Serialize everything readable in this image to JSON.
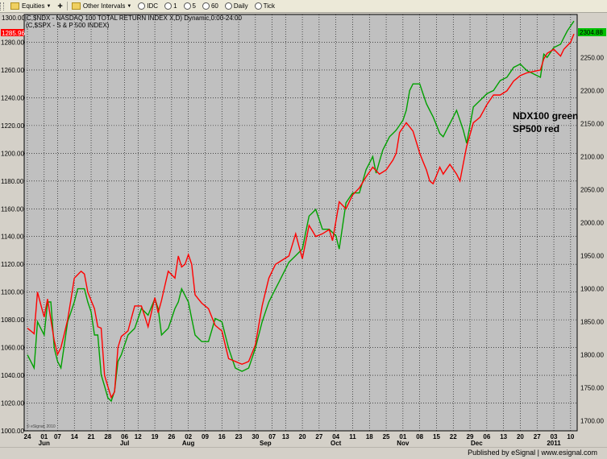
{
  "toolbar": {
    "symbols_label": "Equities",
    "intervals_label": "Other Intervals",
    "idc_label": "IDC",
    "i1_label": "1",
    "i5_label": "5",
    "i60_label": "60",
    "daily_label": "Daily",
    "tick_label": "Tick"
  },
  "chart_header": {
    "line1": "1300.00|C,$NDX - NASDAQ 100 TOTAL RETURN INDEX X,D) Dynamic,0:00-24:00",
    "line2": "(C,$SPX - S & P 500 INDEX)"
  },
  "footer": {
    "text": "Published by eSignal | www.esignal.com"
  },
  "chart_data": {
    "type": "line",
    "colors": {
      "ndx": "#00a000",
      "spx": "#ff0000",
      "background": "#c0c0c0",
      "ndx_badge": "#00c000",
      "spx_badge": "#ff0000"
    },
    "annotation_lines": [
      "NDX100 green",
      "SP500 red"
    ],
    "watermark": "© eSignal, 2010",
    "left_axis": {
      "min": 1000,
      "max": 1300,
      "ticks": [
        "1000.00",
        "1020.00",
        "1040.00",
        "1060.00",
        "1080.00",
        "1100.00",
        "1120.00",
        "1140.00",
        "1160.00",
        "1180.00",
        "1200.00",
        "1220.00",
        "1240.00",
        "1260.00",
        "1280.00"
      ]
    },
    "right_axis": {
      "min": 1685,
      "max": 2315,
      "ticks": [
        "1700.00",
        "1750.00",
        "1800.00",
        "1850.00",
        "1900.00",
        "1950.00",
        "2000.00",
        "2050.00",
        "2100.00",
        "2150.00",
        "2200.00",
        "2250.00"
      ]
    },
    "last_values": {
      "spx": "1285.96",
      "ndx": "2304.88"
    },
    "x_day_ticks": [
      "24",
      "01",
      "07",
      "14",
      "21",
      "28",
      "06",
      "12",
      "19",
      "26",
      "02",
      "09",
      "16",
      "23",
      "30",
      "07",
      "13",
      "20",
      "27",
      "04",
      "11",
      "18",
      "25",
      "01",
      "08",
      "15",
      "22",
      "29",
      "06",
      "13",
      "20",
      "27",
      "03",
      "10"
    ],
    "x_tick_index": [
      0,
      5,
      9,
      14,
      19,
      24,
      29,
      33,
      38,
      43,
      48,
      53,
      58,
      63,
      68,
      73,
      77,
      82,
      87,
      92,
      97,
      102,
      107,
      112,
      117,
      122,
      127,
      132,
      137,
      142,
      147,
      152,
      157,
      162
    ],
    "month_labels": [
      {
        "label": "Jun",
        "index": 5
      },
      {
        "label": "Jul",
        "index": 29
      },
      {
        "label": "Aug",
        "index": 48
      },
      {
        "label": "Sep",
        "index": 71
      },
      {
        "label": "Oct",
        "index": 92
      },
      {
        "label": "Nov",
        "index": 112
      },
      {
        "label": "Dec",
        "index": 134
      },
      {
        "label": "2011",
        "index": 157
      }
    ],
    "num_points": 164,
    "series": [
      {
        "name": "$NDX - NASDAQ 100 TOTAL RETURN INDEX",
        "axis": "right",
        "color": "#00a000",
        "keypoints": [
          [
            0,
            1800
          ],
          [
            2,
            1780
          ],
          [
            3,
            1850
          ],
          [
            5,
            1830
          ],
          [
            6,
            1880
          ],
          [
            7,
            1880
          ],
          [
            8,
            1810
          ],
          [
            9,
            1790
          ],
          [
            10,
            1780
          ],
          [
            12,
            1850
          ],
          [
            14,
            1880
          ],
          [
            15,
            1900
          ],
          [
            17,
            1900
          ],
          [
            18,
            1880
          ],
          [
            19,
            1865
          ],
          [
            20,
            1830
          ],
          [
            21,
            1830
          ],
          [
            22,
            1770
          ],
          [
            24,
            1735
          ],
          [
            25,
            1730
          ],
          [
            26,
            1745
          ],
          [
            27,
            1790
          ],
          [
            28,
            1800
          ],
          [
            30,
            1830
          ],
          [
            32,
            1840
          ],
          [
            34,
            1870
          ],
          [
            36,
            1860
          ],
          [
            38,
            1885
          ],
          [
            39,
            1870
          ],
          [
            40,
            1830
          ],
          [
            42,
            1840
          ],
          [
            44,
            1870
          ],
          [
            45,
            1880
          ],
          [
            46,
            1900
          ],
          [
            48,
            1880
          ],
          [
            50,
            1830
          ],
          [
            52,
            1820
          ],
          [
            54,
            1820
          ],
          [
            56,
            1855
          ],
          [
            58,
            1850
          ],
          [
            60,
            1810
          ],
          [
            62,
            1780
          ],
          [
            64,
            1775
          ],
          [
            66,
            1780
          ],
          [
            68,
            1810
          ],
          [
            70,
            1850
          ],
          [
            72,
            1880
          ],
          [
            74,
            1900
          ],
          [
            76,
            1920
          ],
          [
            78,
            1940
          ],
          [
            80,
            1950
          ],
          [
            82,
            1960
          ],
          [
            84,
            2010
          ],
          [
            86,
            2020
          ],
          [
            88,
            1990
          ],
          [
            90,
            1990
          ],
          [
            92,
            1980
          ],
          [
            93,
            1960
          ],
          [
            95,
            2030
          ],
          [
            97,
            2045
          ],
          [
            99,
            2045
          ],
          [
            101,
            2080
          ],
          [
            103,
            2100
          ],
          [
            104,
            2075
          ],
          [
            106,
            2110
          ],
          [
            108,
            2130
          ],
          [
            110,
            2140
          ],
          [
            112,
            2155
          ],
          [
            113,
            2170
          ],
          [
            114,
            2200
          ],
          [
            115,
            2210
          ],
          [
            117,
            2210
          ],
          [
            119,
            2180
          ],
          [
            121,
            2160
          ],
          [
            123,
            2135
          ],
          [
            124,
            2130
          ],
          [
            126,
            2150
          ],
          [
            128,
            2170
          ],
          [
            130,
            2140
          ],
          [
            131,
            2120
          ],
          [
            133,
            2175
          ],
          [
            135,
            2185
          ],
          [
            137,
            2195
          ],
          [
            139,
            2200
          ],
          [
            141,
            2215
          ],
          [
            143,
            2220
          ],
          [
            145,
            2235
          ],
          [
            147,
            2240
          ],
          [
            149,
            2230
          ],
          [
            151,
            2225
          ],
          [
            153,
            2220
          ],
          [
            154,
            2255
          ],
          [
            155,
            2250
          ],
          [
            157,
            2265
          ],
          [
            159,
            2270
          ],
          [
            161,
            2290
          ],
          [
            163,
            2305
          ]
        ]
      },
      {
        "name": "$SPX - S & P 500 INDEX",
        "axis": "left",
        "color": "#ff0000",
        "keypoints": [
          [
            0,
            1074
          ],
          [
            2,
            1070
          ],
          [
            3,
            1100
          ],
          [
            5,
            1082
          ],
          [
            6,
            1095
          ],
          [
            8,
            1065
          ],
          [
            9,
            1055
          ],
          [
            10,
            1060
          ],
          [
            12,
            1080
          ],
          [
            14,
            1110
          ],
          [
            16,
            1115
          ],
          [
            17,
            1113
          ],
          [
            18,
            1100
          ],
          [
            20,
            1088
          ],
          [
            21,
            1075
          ],
          [
            22,
            1074
          ],
          [
            23,
            1040
          ],
          [
            25,
            1024
          ],
          [
            26,
            1028
          ],
          [
            27,
            1060
          ],
          [
            28,
            1068
          ],
          [
            30,
            1072
          ],
          [
            32,
            1090
          ],
          [
            34,
            1090
          ],
          [
            36,
            1075
          ],
          [
            38,
            1096
          ],
          [
            39,
            1085
          ],
          [
            40,
            1094
          ],
          [
            42,
            1115
          ],
          [
            44,
            1110
          ],
          [
            45,
            1126
          ],
          [
            46,
            1118
          ],
          [
            47,
            1120
          ],
          [
            48,
            1127
          ],
          [
            49,
            1120
          ],
          [
            50,
            1098
          ],
          [
            52,
            1092
          ],
          [
            54,
            1088
          ],
          [
            56,
            1076
          ],
          [
            58,
            1072
          ],
          [
            60,
            1052
          ],
          [
            62,
            1050
          ],
          [
            64,
            1048
          ],
          [
            66,
            1050
          ],
          [
            68,
            1062
          ],
          [
            70,
            1090
          ],
          [
            72,
            1110
          ],
          [
            74,
            1120
          ],
          [
            76,
            1123
          ],
          [
            78,
            1126
          ],
          [
            80,
            1142
          ],
          [
            82,
            1124
          ],
          [
            84,
            1148
          ],
          [
            86,
            1140
          ],
          [
            88,
            1142
          ],
          [
            90,
            1145
          ],
          [
            91,
            1137
          ],
          [
            93,
            1165
          ],
          [
            95,
            1160
          ],
          [
            97,
            1170
          ],
          [
            99,
            1175
          ],
          [
            101,
            1183
          ],
          [
            103,
            1190
          ],
          [
            105,
            1185
          ],
          [
            107,
            1188
          ],
          [
            109,
            1195
          ],
          [
            110,
            1200
          ],
          [
            111,
            1215
          ],
          [
            113,
            1222
          ],
          [
            115,
            1216
          ],
          [
            117,
            1200
          ],
          [
            119,
            1188
          ],
          [
            120,
            1180
          ],
          [
            121,
            1178
          ],
          [
            123,
            1190
          ],
          [
            124,
            1185
          ],
          [
            126,
            1192
          ],
          [
            128,
            1185
          ],
          [
            129,
            1180
          ],
          [
            131,
            1205
          ],
          [
            133,
            1222
          ],
          [
            135,
            1226
          ],
          [
            137,
            1235
          ],
          [
            139,
            1242
          ],
          [
            141,
            1242
          ],
          [
            143,
            1245
          ],
          [
            145,
            1252
          ],
          [
            147,
            1256
          ],
          [
            149,
            1258
          ],
          [
            151,
            1259
          ],
          [
            153,
            1260
          ],
          [
            154,
            1268
          ],
          [
            155,
            1272
          ],
          [
            157,
            1275
          ],
          [
            159,
            1270
          ],
          [
            160,
            1275
          ],
          [
            162,
            1280
          ],
          [
            163,
            1286
          ]
        ]
      }
    ]
  }
}
